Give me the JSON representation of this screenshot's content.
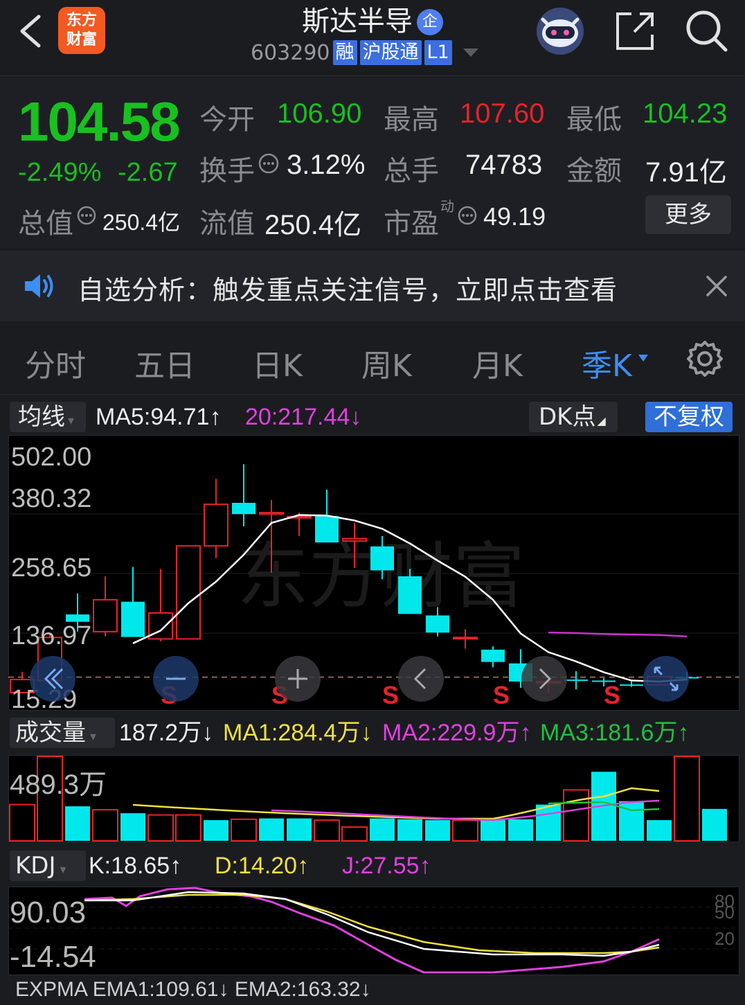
{
  "header": {
    "back_icon": "chevron-left-icon",
    "logo_line1": "东方",
    "logo_line2": "财富",
    "stock_name": "斯达半导",
    "name_badge": "企",
    "stock_code": "603290",
    "tags": [
      "融",
      "沪股通",
      "L1"
    ],
    "assistant_icon": "robot-avatar-icon",
    "share_icon": "share-icon",
    "search_icon": "search-icon"
  },
  "quote": {
    "price": "104.58",
    "change_pct": "-2.49%",
    "change_amt": "-2.67",
    "open_label": "今开",
    "open": "106.90",
    "high_label": "最高",
    "high": "107.60",
    "low_label": "最低",
    "low": "104.23",
    "turnover_label": "换手",
    "turnover": "3.12%",
    "volume_label": "总手",
    "volume": "74783",
    "amount_label": "金额",
    "amount": "7.91亿",
    "mktcap_label": "总值",
    "mktcap": "250.4亿",
    "float_label": "流值",
    "float_cap": "250.4亿",
    "pe_label": "市盈",
    "pe_sup": "动",
    "pe": "49.19",
    "more_button": "更多"
  },
  "notice": {
    "text": "自选分析：触发重点关注信号，立即点击查看"
  },
  "tabs": [
    "分时",
    "五日",
    "日K",
    "周K",
    "月K",
    "季K"
  ],
  "active_tab": "季K",
  "toolbar": {
    "indicator": "均线",
    "ma5": "MA5:94.71↑",
    "ma20": "20:217.44↓",
    "dk_button": "DK点",
    "adjust_button": "不复权"
  },
  "chart_data": [
    {
      "type": "candlestick",
      "y_axis_labels": [
        "502.00",
        "380.32",
        "258.65",
        "136.97",
        "15.29"
      ],
      "ylim": [
        15.29,
        502.0
      ],
      "watermark": "东方财富",
      "ohlc": [
        {
          "o": 15.3,
          "h": 58,
          "l": 15.3,
          "c": 42,
          "dir": "up"
        },
        {
          "o": 40,
          "h": 135,
          "l": 30,
          "c": 128,
          "dir": "up"
        },
        {
          "o": 160,
          "h": 218,
          "l": 140,
          "c": 175,
          "dir": "down"
        },
        {
          "o": 140,
          "h": 253,
          "l": 130,
          "c": 205,
          "dir": "up"
        },
        {
          "o": 201,
          "h": 272,
          "l": 155,
          "c": 129,
          "dir": "down"
        },
        {
          "o": 125,
          "h": 268,
          "l": 120,
          "c": 178,
          "dir": "up"
        },
        {
          "o": 125,
          "h": 306,
          "l": 125,
          "c": 315,
          "dir": "up"
        },
        {
          "o": 315,
          "h": 452,
          "l": 290,
          "c": 400,
          "dir": "up"
        },
        {
          "o": 403,
          "h": 482,
          "l": 355,
          "c": 380,
          "dir": "down"
        },
        {
          "o": 380,
          "h": 409,
          "l": 260,
          "c": 383,
          "dir": "up"
        },
        {
          "o": 373,
          "h": 383,
          "l": 335,
          "c": 375,
          "dir": "up"
        },
        {
          "o": 376,
          "h": 430,
          "l": 335,
          "c": 322,
          "dir": "down"
        },
        {
          "o": 330,
          "h": 362,
          "l": 270,
          "c": 325,
          "dir": "up"
        },
        {
          "o": 314,
          "h": 335,
          "l": 247,
          "c": 265,
          "dir": "down"
        },
        {
          "o": 253,
          "h": 268,
          "l": 180,
          "c": 176,
          "dir": "down"
        },
        {
          "o": 173,
          "h": 190,
          "l": 130,
          "c": 138,
          "dir": "down"
        },
        {
          "o": 128,
          "h": 145,
          "l": 105,
          "c": 128,
          "dir": "up"
        },
        {
          "o": 103,
          "h": 110,
          "l": 67,
          "c": 78,
          "dir": "down"
        },
        {
          "o": 75,
          "h": 104,
          "l": 25,
          "c": 38,
          "dir": "down"
        },
        {
          "o": 37,
          "h": 42,
          "l": 15,
          "c": 38,
          "dir": "up"
        },
        {
          "o": 42,
          "h": 59,
          "l": 22,
          "c": 42,
          "dir": "down"
        },
        {
          "o": 40,
          "h": 45,
          "l": 28,
          "c": 38,
          "dir": "down"
        },
        {
          "o": 32,
          "h": 38,
          "l": 27,
          "c": 31,
          "dir": "down"
        },
        {
          "o": 31,
          "h": 50,
          "l": 31,
          "c": 48,
          "dir": "up"
        },
        {
          "o": 46,
          "h": 58,
          "l": 40,
          "c": 47,
          "dir": "down"
        }
      ],
      "ma5": [
        null,
        null,
        null,
        null,
        116,
        142,
        198,
        242,
        297,
        362,
        378,
        377,
        367,
        350,
        320,
        285,
        252,
        205,
        136,
        98,
        79,
        57,
        40,
        38,
        42
      ],
      "ma20": [
        null,
        null,
        null,
        null,
        null,
        null,
        null,
        null,
        null,
        null,
        null,
        null,
        null,
        null,
        null,
        null,
        null,
        null,
        null,
        138,
        137,
        135,
        134,
        133,
        130
      ],
      "signals": [
        "S",
        "S",
        "S",
        "S",
        "S"
      ],
      "controls": [
        "rewind-icon",
        "zoom-out-icon",
        "zoom-in-icon",
        "prev-icon",
        "next-icon",
        "expand-icon"
      ]
    },
    {
      "type": "bar",
      "indicator_label": "成交量",
      "current": "187.2万↓",
      "ma1": "MA1:284.4万↓",
      "ma2": "MA2:229.9万↑",
      "ma3": "MA3:181.6万↑",
      "y_axis_labels": [
        "489.3万"
      ],
      "ylim": [
        0,
        489.3
      ],
      "unit": "万",
      "values": [
        210,
        489.3,
        200,
        180,
        160,
        150,
        150,
        120,
        125,
        130,
        130,
        120,
        80,
        130,
        125,
        120,
        120,
        120,
        125,
        210,
        295,
        400,
        230,
        120,
        489.3,
        185
      ],
      "dir": [
        "up",
        "up",
        "down",
        "up",
        "down",
        "up",
        "up",
        "down",
        "up",
        "down",
        "down",
        "up",
        "up",
        "down",
        "down",
        "down",
        "up",
        "down",
        "down",
        "down",
        "up",
        "down",
        "down",
        "down",
        "up",
        "down"
      ]
    },
    {
      "type": "line",
      "indicator_label": "KDJ",
      "k": "K:18.65↑",
      "d": "D:14.20↑",
      "j": "J:27.55↑",
      "y_axis_labels": [
        "90.03",
        "-14.54"
      ],
      "right_labels": [
        "80",
        "50",
        "20"
      ],
      "ylim": [
        -14.54,
        90.03
      ]
    }
  ],
  "bottom_label": "EXPMA  EMA1:109.61↓  EMA2:163.32↓"
}
